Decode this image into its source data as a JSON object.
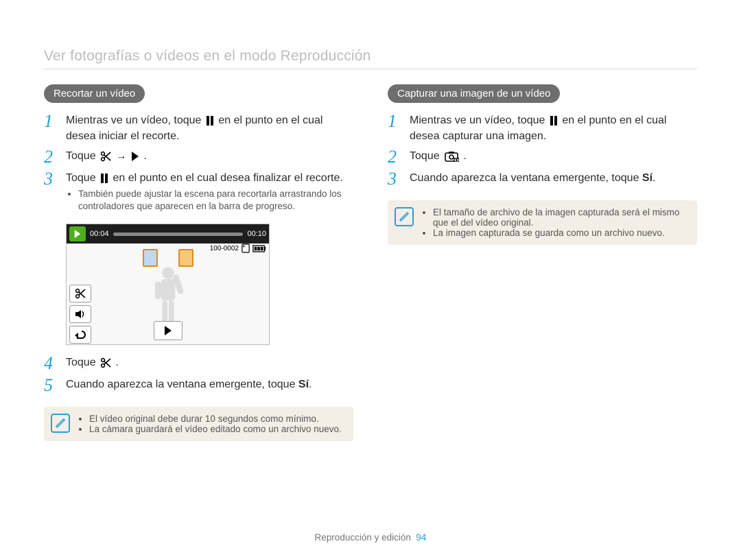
{
  "header": {
    "title": "Ver fotografías o vídeos en el modo Reproducción"
  },
  "left": {
    "pill": "Recortar un vídeo",
    "steps": [
      {
        "n": "1",
        "pre": "Mientras ve un vídeo, toque ",
        "post": " en el punto en el cual desea iniciar el recorte.",
        "icon": "pause"
      },
      {
        "n": "2",
        "pre": "Toque ",
        "post": " → ",
        "tail": ".",
        "icon": "scissors",
        "icon2": "play-solid"
      },
      {
        "n": "3",
        "pre": "Toque ",
        "post": " en el punto en el cual desea finalizar el recorte.",
        "icon": "pause"
      }
    ],
    "sub3": "También puede ajustar la escena para recortarla arrastrando los controladores que aparecen en la barra de progreso.",
    "step4": {
      "n": "4",
      "pre": "Toque ",
      "post": ".",
      "icon": "scissors"
    },
    "step5": {
      "n": "5",
      "text": "Cuando aparezca la ventana emergente, toque ",
      "bold": "Sí",
      "tail": "."
    },
    "note": [
      "El vídeo original debe durar 10 segundos como mínimo.",
      "La cámara guardará el vídeo editado como un archivo nuevo."
    ],
    "shot": {
      "cur": "00:04",
      "total": "00:10",
      "file": "100-0002"
    }
  },
  "right": {
    "pill": "Capturar una imagen de un vídeo",
    "steps": [
      {
        "n": "1",
        "pre": "Mientras ve un vídeo, toque ",
        "post": " en el punto en el cual desea capturar una imagen.",
        "icon": "pause"
      },
      {
        "n": "2",
        "pre": "Toque ",
        "post": ".",
        "icon": "capture"
      },
      {
        "n": "3",
        "text": "Cuando aparezca la ventana emergente, toque ",
        "bold": "Sí",
        "tail": "."
      }
    ],
    "note": [
      "El tamaño de archivo de la imagen capturada será el mismo que el del vídeo original.",
      "La imagen capturada se guarda como un archivo nuevo."
    ]
  },
  "footer": {
    "section": "Reproducción y edición",
    "page": "94"
  }
}
